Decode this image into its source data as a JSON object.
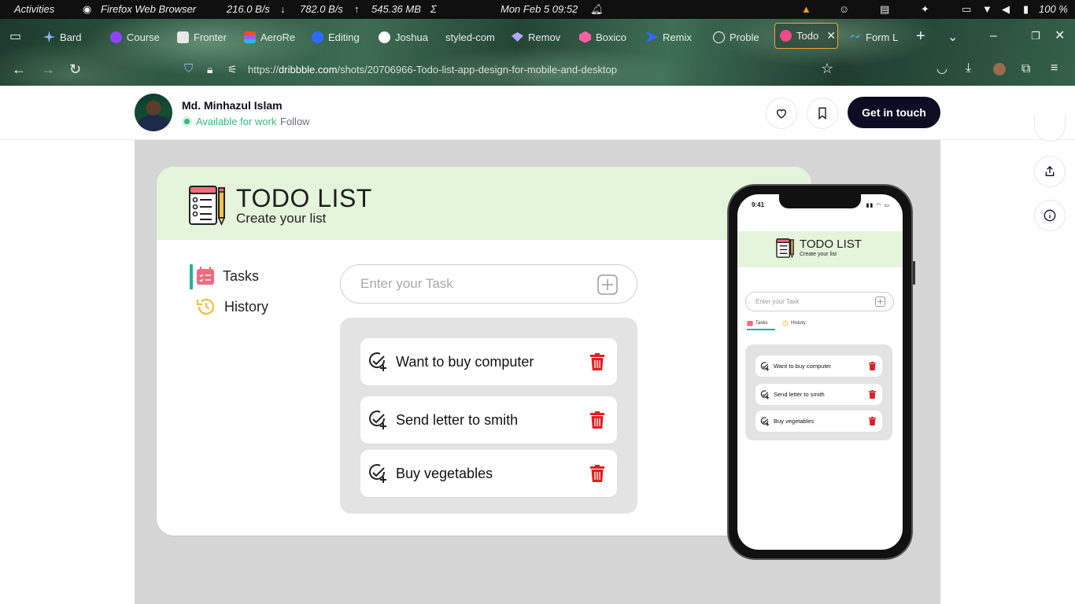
{
  "system_bar": {
    "activities": "Activities",
    "app": "Firefox Web Browser",
    "net_down": "216.0 B/s",
    "net_up": "782.0 B/s",
    "memory": "545.36 MB",
    "sigma": "Σ",
    "clock": "Mon Feb 5  09:52",
    "battery": "100 %"
  },
  "browser": {
    "tabs": [
      {
        "label": "Bard",
        "color": "#8ab4f8"
      },
      {
        "label": "Course",
        "color": "#8e44ff"
      },
      {
        "label": "Fronter",
        "color": "#e8e8e8"
      },
      {
        "label": "AeroRe",
        "color": "#f24e1e"
      },
      {
        "label": "Editing",
        "color": "#2f6bff"
      },
      {
        "label": "Joshua",
        "color": "#ffffff"
      },
      {
        "label": "styled-com",
        "color": "#db7093"
      },
      {
        "label": "Remov",
        "color": "#b3a8ff"
      },
      {
        "label": "Boxico",
        "color": "#ff5fa2"
      },
      {
        "label": "Remix",
        "color": "#2f6bff"
      },
      {
        "label": "Proble",
        "color": "#ffffff"
      },
      {
        "label": "Todo",
        "color": "#ea4c89"
      },
      {
        "label": "Form L",
        "color": "#38bdf8"
      }
    ],
    "url_prefix": "https://",
    "url_domain": "dribbble.com",
    "url_path": "/shots/20706966-Todo-list-app-design-for-mobile-and-desktop"
  },
  "header": {
    "author_name": "Md. Minhazul Islam",
    "availability": "Available for work",
    "follow": "Follow",
    "cta": "Get in touch"
  },
  "desktop_app": {
    "title": "TODO LIST",
    "subtitle": "Create your list",
    "nav": [
      {
        "label": "Tasks",
        "icon": "calendar-tasks-icon"
      },
      {
        "label": "History",
        "icon": "history-icon"
      }
    ],
    "input_placeholder": "Enter your Task",
    "tasks": [
      "Want to buy computer",
      "Send letter to smith",
      "Buy vegetables"
    ]
  },
  "mobile_app": {
    "time": "9:41",
    "title": "TODO LIST",
    "subtitle": "Create your list",
    "input_placeholder": "Enter your Task",
    "tabs": [
      "Tasks",
      "History"
    ],
    "tasks": [
      "Want to buy computer",
      "Send letter to smith",
      "Buy vegetables"
    ]
  },
  "colors": {
    "accent_green": "#1fb39a",
    "header_green": "#e4f5dc",
    "delete_red": "#e02020",
    "tasks_icon_pink": "#f26b7c",
    "history_icon_yellow": "#f3c04a",
    "cta_dark": "#0d0c22"
  }
}
